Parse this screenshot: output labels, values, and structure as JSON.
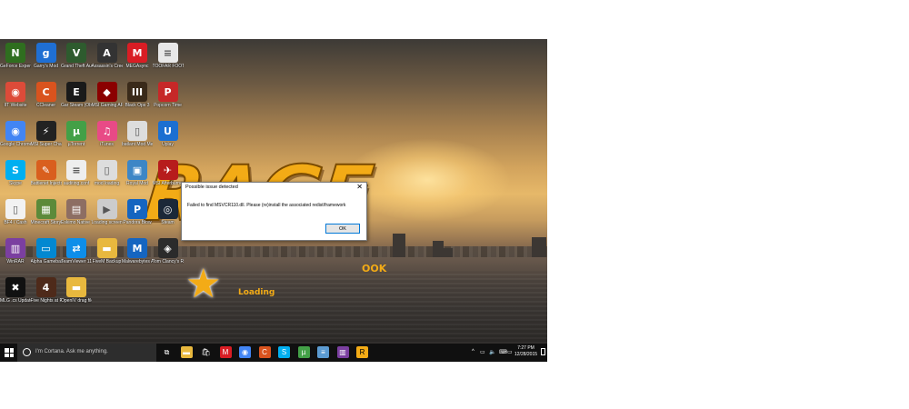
{
  "desktop": {
    "icons": [
      {
        "label": "GeForce Experience",
        "icon": "nvidia-icon",
        "color": "#2f6e1f",
        "glyph": "N"
      },
      {
        "label": "Garry's Mod",
        "icon": "garrys-mod-icon",
        "color": "#1f6fd3",
        "glyph": "g"
      },
      {
        "label": "Grand Theft Auto V",
        "icon": "gta-v-icon",
        "color": "#2e5b2e",
        "glyph": "V"
      },
      {
        "label": "Assassin's Creed IV",
        "icon": "assassins-creed-icon",
        "color": "#333333",
        "glyph": "A"
      },
      {
        "label": "MEGAsync",
        "icon": "mega-icon",
        "color": "#d91d24",
        "glyph": "M"
      },
      {
        "label": "TOOFAR FOOTWEAR...",
        "icon": "document-icon",
        "color": "#e8e8e8",
        "glyph": "≡"
      },
      {
        "label": "IIT Website",
        "icon": "chrome-icon",
        "color": "#dd4b39",
        "glyph": "◉"
      },
      {
        "label": "CCleaner",
        "icon": "ccleaner-icon",
        "color": "#d9531e",
        "glyph": "C"
      },
      {
        "label": "Gar Steam (Oblivion Rom)",
        "icon": "ea-icon",
        "color": "#1a1a1a",
        "glyph": "E"
      },
      {
        "label": "MSI Gaming APP",
        "icon": "msi-icon",
        "color": "#8b0000",
        "glyph": "◆"
      },
      {
        "label": "Black Ops 3",
        "icon": "black-ops-icon",
        "color": "#3a2a1a",
        "glyph": "III"
      },
      {
        "label": "Popcorn Time",
        "icon": "popcorn-icon",
        "color": "#c62828",
        "glyph": "P"
      },
      {
        "label": "Google Chrome",
        "icon": "chrome-icon",
        "color": "#4285f4",
        "glyph": "◉"
      },
      {
        "label": "MSI Super Charger",
        "icon": "msi-charger-icon",
        "color": "#222222",
        "glyph": "⚡"
      },
      {
        "label": "µTorrent",
        "icon": "utorrent-icon",
        "color": "#43a047",
        "glyph": "µ"
      },
      {
        "label": "iTunes",
        "icon": "itunes-icon",
        "color": "#e84a86",
        "glyph": "♫"
      },
      {
        "label": "batlant Mod Menu",
        "icon": "file-icon",
        "color": "#dddddd",
        "glyph": "▯"
      },
      {
        "label": "Uplay",
        "icon": "uplay-icon",
        "color": "#1b6fd1",
        "glyph": "U"
      },
      {
        "label": "Skype",
        "icon": "skype-icon",
        "color": "#00aff0",
        "glyph": "S"
      },
      {
        "label": "Battlenet Injector",
        "icon": "injector-icon",
        "color": "#d95f1e",
        "glyph": "✎"
      },
      {
        "label": "auditing.conf",
        "icon": "text-file-icon",
        "color": "#eeeeee",
        "glyph": "≡"
      },
      {
        "label": "mod loading",
        "icon": "file-icon",
        "color": "#dddddd",
        "glyph": "▯"
      },
      {
        "label": "Royal Mod",
        "icon": "package-icon",
        "color": "#3d86c6",
        "glyph": "▣"
      },
      {
        "label": "MSI Afterburner",
        "icon": "afterburner-icon",
        "color": "#b71c1c",
        "glyph": "✈"
      },
      {
        "label": "BF4 / Cash",
        "icon": "file-icon",
        "color": "#f2f2f2",
        "glyph": "▯"
      },
      {
        "label": "Minecraft Story Mode",
        "icon": "minecraft-icon",
        "color": "#5c8a3a",
        "glyph": "▦"
      },
      {
        "label": "Eskimo Native Tunes",
        "icon": "archive-icon",
        "color": "#8d6e63",
        "glyph": "▤"
      },
      {
        "label": "Loading screen.avi",
        "icon": "video-file-icon",
        "color": "#cccccc",
        "glyph": "▶"
      },
      {
        "label": "Pandora Blow",
        "icon": "pandora-icon",
        "color": "#1565c0",
        "glyph": "P"
      },
      {
        "label": "Steam",
        "icon": "steam-icon",
        "color": "#1b2838",
        "glyph": "◎"
      },
      {
        "label": "WinRAR",
        "icon": "winrar-icon",
        "color": "#7b3fa0",
        "glyph": "▥"
      },
      {
        "label": "Alpha Gamebase",
        "icon": "monitor-icon",
        "color": "#0288d1",
        "glyph": "▭"
      },
      {
        "label": "TeamViewer 11",
        "icon": "teamviewer-icon",
        "color": "#0e8ee9",
        "glyph": "⇄"
      },
      {
        "label": "FiveM Backup",
        "icon": "folder-icon",
        "color": "#e8b83e",
        "glyph": "▬"
      },
      {
        "label": "Malwarebytes Anti-Malw...",
        "icon": "malwarebytes-icon",
        "color": "#1565c0",
        "glyph": "M"
      },
      {
        "label": "Tom Clancy's Rainbow Si...",
        "icon": "rainbow-six-icon",
        "color": "#2b2b2b",
        "glyph": "◈"
      },
      {
        "label": "MLG .cs Update 1",
        "icon": "mlg-icon",
        "color": "#111111",
        "glyph": "✖"
      },
      {
        "label": "Five Nights at Freddy's...",
        "icon": "fnaf-icon",
        "color": "#4e2a1a",
        "glyph": "4"
      },
      {
        "label": "OpenIV drag files",
        "icon": "folder-icon",
        "color": "#e8b83e",
        "glyph": "▬"
      }
    ],
    "wallpaper": {
      "logo_text": "RAGE",
      "logo_tag": "OOK",
      "loading_text": "Loading"
    }
  },
  "dialog": {
    "title": "Possible issue detected",
    "close_glyph": "✕",
    "message": "Failed to find MSVCR110.dll. Please (re)install the associated redist/framework",
    "ok_label": "OK"
  },
  "taskbar": {
    "search_placeholder": "I'm Cortana. Ask me anything.",
    "apps": [
      {
        "name": "task-view-icon",
        "glyph": "⧉",
        "color": "#101010"
      },
      {
        "name": "file-explorer-icon",
        "glyph": "▬",
        "color": "#e8b83e"
      },
      {
        "name": "store-icon",
        "glyph": "🛍",
        "color": "#101010"
      },
      {
        "name": "mega-icon",
        "glyph": "M",
        "color": "#d91d24"
      },
      {
        "name": "chrome-icon",
        "glyph": "◉",
        "color": "#4285f4"
      },
      {
        "name": "ccleaner-icon",
        "glyph": "C",
        "color": "#d9531e"
      },
      {
        "name": "skype-icon",
        "glyph": "S",
        "color": "#00aff0"
      },
      {
        "name": "utorrent-icon",
        "glyph": "µ",
        "color": "#43a047"
      },
      {
        "name": "notepad-icon",
        "glyph": "≡",
        "color": "#5c9bd1"
      },
      {
        "name": "winrar-icon",
        "glyph": "▥",
        "color": "#7b3fa0"
      },
      {
        "name": "rage-app-icon",
        "glyph": "R",
        "color": "#f3ab16"
      }
    ],
    "tray": {
      "chevron": "^",
      "network": "▭",
      "volume": "🔈",
      "language": "⌨",
      "message": "▭"
    },
    "time": "7:27 PM",
    "date": "12/28/2015"
  }
}
